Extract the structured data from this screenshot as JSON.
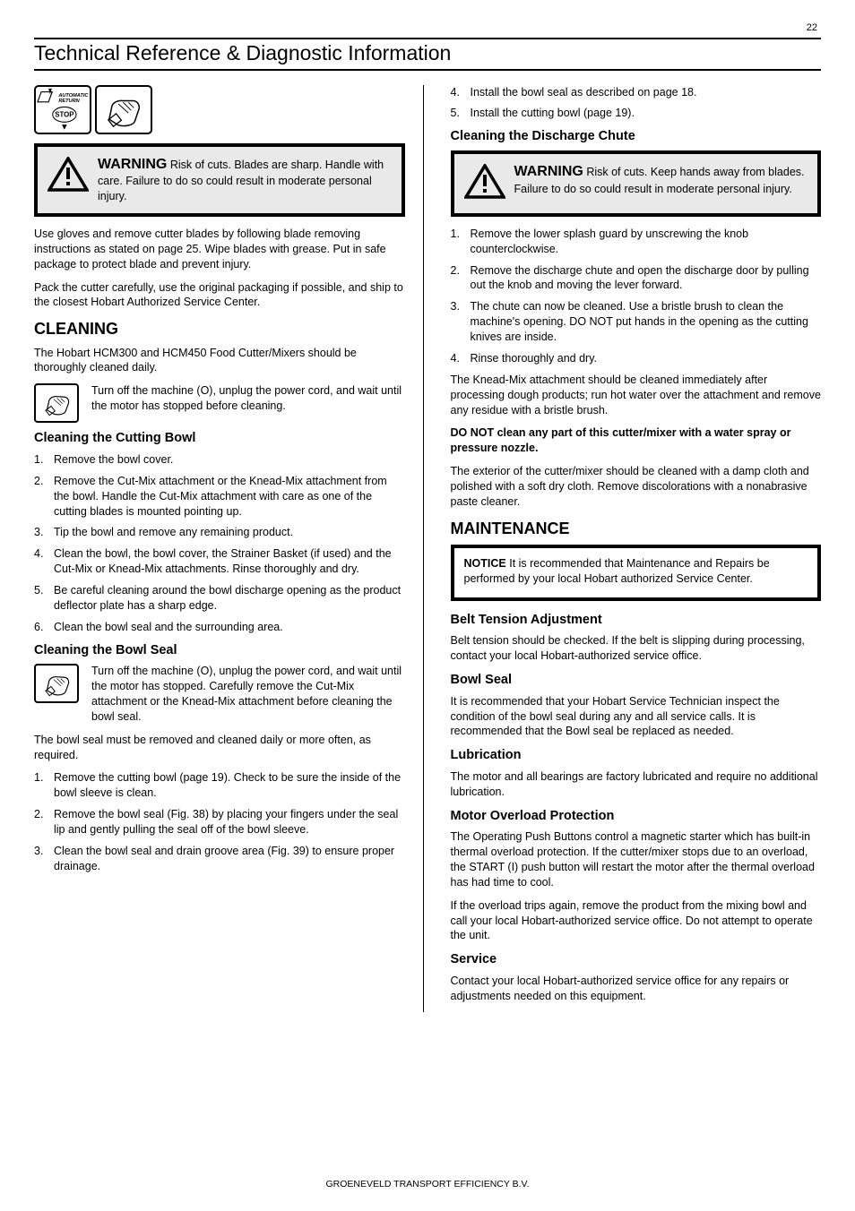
{
  "page_header": {
    "page_number": "22",
    "title": "Technical Reference & Diagnostic Information"
  },
  "footer": "GROENEVELD TRANSPORT EFFICIENCY B.V.",
  "leftcol": {
    "symbol_auto_return_text": "AUTOMATIC RETURN",
    "symbol_stop_text": "STOP",
    "warning1": {
      "title": "WARNING",
      "body": "Risk of cuts. Blades are sharp. Handle with care. Failure to do so could result in moderate personal injury."
    },
    "p1": "Use gloves and remove cutter blades by following blade removing instructions as stated on page 25. Wipe blades with grease. Put in safe package to protect blade and prevent injury.",
    "p2": "Pack the cutter carefully, use the original packaging if possible, and ship to the closest Hobart Authorized Service Center.",
    "h2_cleaning": "CLEANING",
    "p3": "The Hobart HCM300 and HCM450 Food Cutter/Mixers should be thoroughly cleaned daily.",
    "p4_icon_text": "Turn off the machine (O), unplug the power cord, and wait until the motor has stopped before cleaning.",
    "h3_clean_bowl": "Cleaning the Cutting Bowl",
    "ol_bowl": [
      "Remove the bowl cover.",
      "Remove the Cut-Mix attachment or the Knead-Mix attachment from the bowl. Handle the Cut-Mix attachment with care as one of the cutting blades is mounted pointing up.",
      "Tip the bowl and remove any remaining product.",
      "Clean the bowl, the bowl cover, the Strainer Basket (if used) and the Cut-Mix or Knead-Mix attachments. Rinse thoroughly and dry.",
      "Be careful cleaning around the bowl discharge opening as the product deflector plate has a sharp edge.",
      "Clean the bowl seal and the surrounding area."
    ],
    "h3_clean_seal": "Cleaning the Bowl Seal",
    "p5_icon_text": "Turn off the machine (O), unplug the power cord, and wait until the motor has stopped. Carefully remove the Cut-Mix attachment or the Knead-Mix attachment before cleaning the bowl seal.",
    "p6": "The bowl seal must be removed and cleaned daily or more often, as required.",
    "ol_seal": [
      "Remove the cutting bowl (page 19). Check to be sure the inside of the bowl sleeve is clean.",
      "Remove the bowl seal (Fig. 38) by placing your fingers under the seal lip and gently pulling the seal off of the bowl sleeve.",
      "Clean the bowl seal and drain groove area (Fig. 39) to ensure proper drainage."
    ]
  },
  "rightcol": {
    "ol_seal_cont": [
      {
        "n": "4",
        "t": "Install the bowl seal as described on page 18."
      },
      {
        "n": "5",
        "t": "Install the cutting bowl (page 19)."
      }
    ],
    "h3_clean_chute": "Cleaning the Discharge Chute",
    "warning2": {
      "title": "WARNING",
      "body": "Risk of cuts. Keep hands away from blades. Failure to do so could result in moderate personal injury."
    },
    "ol_chute": [
      "Remove the lower splash guard by unscrewing the knob counterclockwise.",
      "Remove the discharge chute and open the discharge door by pulling out the knob and moving the lever forward.",
      "The chute can now be cleaned. Use a bristle brush to clean the machine's opening. DO NOT put hands in the opening as the cutting knives are inside.",
      "Rinse thoroughly and dry."
    ],
    "p_knead": "The Knead-Mix attachment should be cleaned immediately after processing dough products; run hot water over the attachment and remove any residue with a bristle brush.",
    "note_strong": "DO NOT clean any part of this cutter/mixer with a water spray or pressure nozzle.",
    "p_exterior": "The exterior of the cutter/mixer should be cleaned with a damp cloth and polished with a soft dry cloth. Remove discolorations with a nonabrasive paste cleaner.",
    "h2_maint": "MAINTENANCE",
    "notice": {
      "title": "NOTICE",
      "body": "It is recommended that Maintenance and Repairs be performed by your local Hobart authorized Service Center."
    },
    "h3_belt": "Belt Tension Adjustment",
    "p_belt": "Belt tension should be checked. If the belt is slipping during processing, contact your local Hobart-authorized service office.",
    "h3_bowlseal": "Bowl Seal",
    "p_bowlseal": "It is recommended that your Hobart Service Technician inspect the condition of the bowl seal during any and all service calls. It is recommended that the Bowl seal be replaced as needed.",
    "h3_lube": "Lubrication",
    "p_lube": "The motor and all bearings are factory lubricated and require no additional lubrication.",
    "h3_motor": "Motor Overload Protection",
    "p_motor1": "The Operating Push Buttons control a magnetic starter which has built-in thermal overload protection. If the cutter/mixer stops due to an overload, the START (I) push button will restart the motor after the thermal overload has had time to cool.",
    "p_motor2": "If the overload trips again, remove the product from the mixing bowl and call your local Hobart-authorized service office. Do not attempt to operate the unit.",
    "h3_service": "Service",
    "p_service": "Contact your local Hobart-authorized service office for any repairs or adjustments needed on this equipment."
  }
}
